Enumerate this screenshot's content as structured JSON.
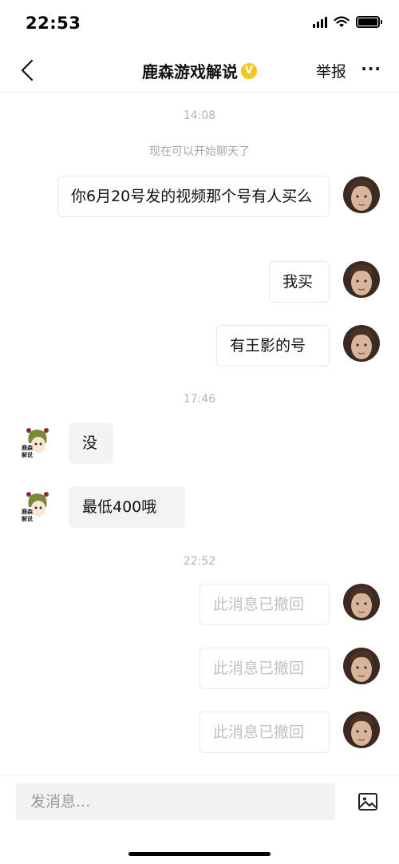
{
  "status": {
    "time": "22:53"
  },
  "header": {
    "title": "鹿森游戏解说",
    "verified_mark": "V",
    "report_label": "举报",
    "more_label": "···"
  },
  "chat": {
    "timestamp1": "14:08",
    "system_note": "现在可以开始聊天了",
    "msg1": "你6月20号发的视频那个号有人买么",
    "msg2": "我买",
    "msg3": "有王影的号",
    "timestamp2": "17:46",
    "msg4": "没",
    "msg5": "最低400哦",
    "timestamp3": "22:52",
    "recalled1": "此消息已撤回",
    "recalled2": "此消息已撤回",
    "recalled3": "此消息已撤回",
    "left_avatar_text": "鹿森解说"
  },
  "input": {
    "placeholder": "发消息..."
  },
  "icons": [
    "back-arrow-icon",
    "verified-badge-icon",
    "more-icon",
    "signal-icon",
    "wifi-icon",
    "battery-icon",
    "image-icon"
  ],
  "colors": {
    "verified": "#f5c518",
    "incoming_bubble": "#f3f3f3",
    "recalled_text": "#c2c2c2"
  }
}
